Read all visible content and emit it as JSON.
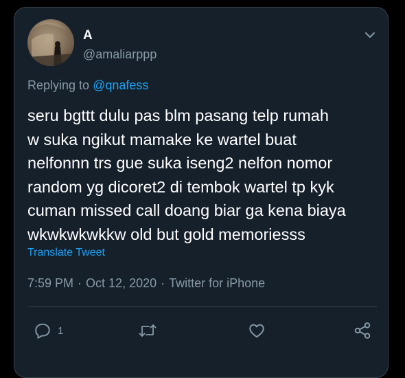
{
  "tweet": {
    "display_name": "A",
    "handle": "@amaliarppp",
    "replying_prefix": "Replying to",
    "replying_to": "@qnafess",
    "text_lines": [
      "seru bgttt dulu pas blm pasang telp rumah",
      "w suka ngikut mamake ke wartel buat",
      "nelfonnn trs gue suka iseng2 nelfon nomor",
      "random yg dicoret2 di tembok wartel tp kyk",
      "cuman missed call doang biar ga kena biaya",
      "wkwkwkwkkw old but gold memoriesss"
    ],
    "translate_label": "Translate Tweet",
    "time": "7:59 PM",
    "date": "Oct 12, 2020",
    "source": "Twitter for iPhone",
    "separator": "·"
  },
  "actions": {
    "reply_count": "1",
    "icons": [
      "reply-icon",
      "retweet-icon",
      "like-icon",
      "share-icon"
    ]
  },
  "colors": {
    "background": "#15202b",
    "text": "#ffffff",
    "muted": "#8899a6",
    "accent": "#1da1f2",
    "border": "#38444d"
  }
}
